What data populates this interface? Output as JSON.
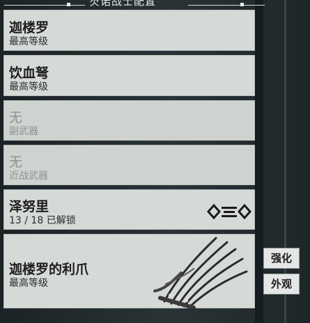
{
  "header": {
    "title": "芡诺战士配置"
  },
  "slots": [
    {
      "name": "迦楼罗",
      "sub": "最高等级"
    },
    {
      "name": "饮血弩",
      "sub": "最高等级"
    },
    {
      "name": "无",
      "sub": "副武器"
    },
    {
      "name": "无",
      "sub": "近战武器"
    },
    {
      "name": "泽努里",
      "sub": "13 / 18 已解锁",
      "icon": "polarity-symbol-icon"
    },
    {
      "name": "迦楼罗的利爪",
      "sub": "最高等级",
      "icon": "claw-weapon-icon"
    }
  ],
  "side_buttons": {
    "upgrade": "强化",
    "appearance": "外观"
  },
  "colors": {
    "panel": "#d6dad7",
    "empty_text": "#8d918f",
    "background": "#232c2f"
  }
}
